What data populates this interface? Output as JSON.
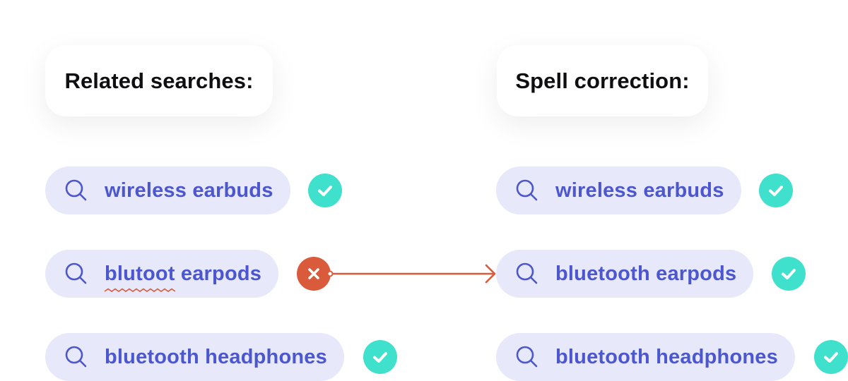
{
  "colors": {
    "chip_bg": "#e7e8fa",
    "term_text": "#4b56cf",
    "check_bg": "#3fe0cc",
    "error_bg": "#d95b3c",
    "header_text": "#0f0f12"
  },
  "related_searches": {
    "title": "Related searches:",
    "items": [
      {
        "term": "wireless earbuds",
        "status": "correct",
        "status_icon": "check-icon"
      },
      {
        "term_misspelled": "blutoot",
        "term_rest": " earpods",
        "status": "incorrect",
        "status_icon": "x-icon"
      },
      {
        "term": "bluetooth headphones",
        "status": "correct",
        "status_icon": "check-icon"
      }
    ]
  },
  "spell_correction": {
    "title": "Spell correction:",
    "items": [
      {
        "term": "wireless earbuds",
        "status": "correct",
        "status_icon": "check-icon"
      },
      {
        "term": "bluetooth earpods",
        "status": "correct",
        "status_icon": "check-icon"
      },
      {
        "term": "bluetooth headphones",
        "status": "correct",
        "status_icon": "check-icon"
      }
    ]
  },
  "correction_arrow": {
    "from": "blutoot earpods",
    "to": "bluetooth earpods"
  }
}
